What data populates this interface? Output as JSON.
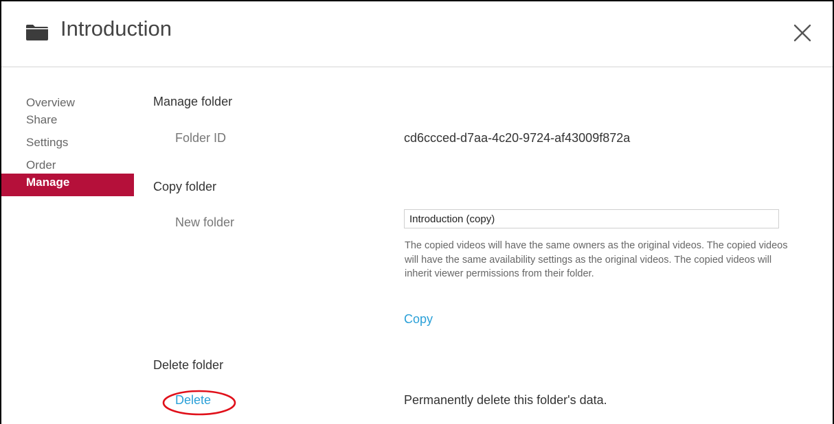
{
  "header": {
    "title": "Introduction",
    "folder_icon": "folder-icon",
    "close_icon": "close-icon"
  },
  "sidebar": {
    "items": [
      {
        "label": "Overview",
        "active": false
      },
      {
        "label": "Share",
        "active": false
      },
      {
        "label": "Settings",
        "active": false
      },
      {
        "label": "Order",
        "active": false
      },
      {
        "label": "Manage",
        "active": true
      }
    ]
  },
  "manage": {
    "section_title": "Manage folder",
    "folder_id_label": "Folder ID",
    "folder_id_value": "cd6ccced-d7aa-4c20-9724-af43009f872a"
  },
  "copy": {
    "section_title": "Copy folder",
    "new_folder_label": "New folder",
    "new_folder_value": "Introduction (copy)",
    "help_text": "The copied videos will have the same owners as the original videos. The copied videos will have the same availability settings as the original videos. The copied videos will inherit viewer permissions from their folder.",
    "copy_link": "Copy"
  },
  "delete": {
    "section_title": "Delete folder",
    "delete_link": "Delete",
    "description": "Permanently delete this folder's data."
  },
  "colors": {
    "accent": "#b5103a",
    "link": "#2aa0d8",
    "annotation": "#e0101a"
  }
}
